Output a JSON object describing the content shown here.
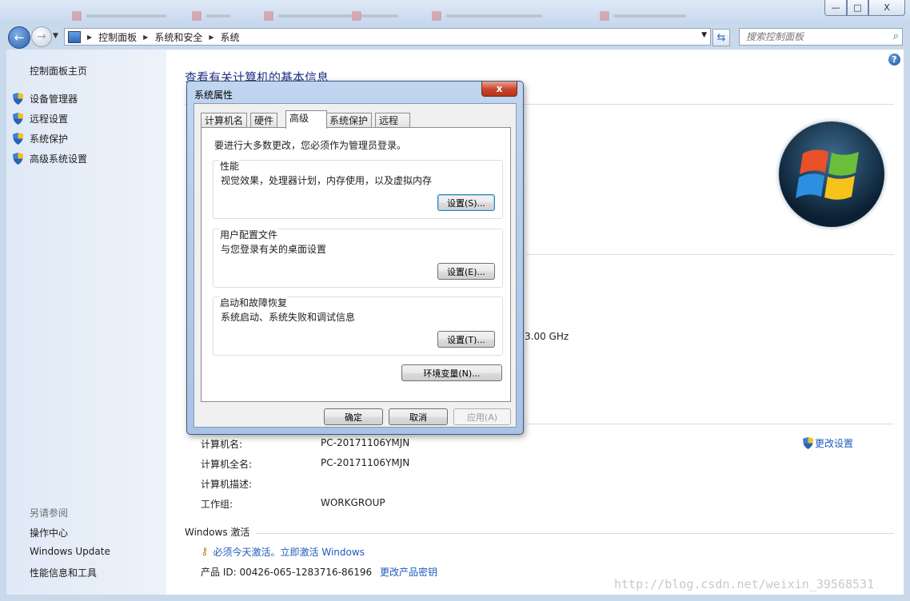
{
  "window": {
    "buttons": {
      "minimize": "—",
      "maximize": "□",
      "close": "X"
    }
  },
  "address_bar": {
    "breadcrumbs": [
      "控制面板",
      "系统和安全",
      "系统"
    ],
    "search_placeholder": "搜索控制面板"
  },
  "sidebar": {
    "home": "控制面板主页",
    "items": [
      {
        "label": "设备管理器",
        "icon": "uac-shield-icon"
      },
      {
        "label": "远程设置",
        "icon": "uac-shield-icon"
      },
      {
        "label": "系统保护",
        "icon": "uac-shield-icon"
      },
      {
        "label": "高级系统设置",
        "icon": "uac-shield-icon"
      }
    ],
    "see_also_heading": "另请参阅",
    "see_also": [
      "操作中心",
      "Windows Update",
      "性能信息和工具"
    ]
  },
  "main": {
    "title": "查看有关计算机的基本信息",
    "cpu_speed_fragment": "3.00 GHz",
    "computer_name_section": {
      "rows": [
        {
          "label": "计算机名:",
          "value": "PC-20171106YMJN"
        },
        {
          "label": "计算机全名:",
          "value": "PC-20171106YMJN"
        },
        {
          "label": "计算机描述:",
          "value": ""
        },
        {
          "label": "工作组:",
          "value": "WORKGROUP"
        }
      ],
      "change_settings": "更改设置"
    },
    "activation": {
      "heading": "Windows 激活",
      "notice": "必须今天激活。立即激活 Windows",
      "product_id_label": "产品 ID: 00426-065-1283716-86196",
      "change_key": "更改产品密钥"
    },
    "watermark": "http://blog.csdn.net/weixin_39568531"
  },
  "dialog": {
    "title": "系统属性",
    "close_label": "x",
    "tabs": [
      "计算机名",
      "硬件",
      "高级",
      "系统保护",
      "远程"
    ],
    "active_tab": "高级",
    "admin_note": "要进行大多数更改，您必须作为管理员登录。",
    "groups": [
      {
        "title": "性能",
        "desc": "视觉效果，处理器计划，内存使用，以及虚拟内存",
        "button": "设置(S)..."
      },
      {
        "title": "用户配置文件",
        "desc": "与您登录有关的桌面设置",
        "button": "设置(E)..."
      },
      {
        "title": "启动和故障恢复",
        "desc": "系统启动、系统失败和调试信息",
        "button": "设置(T)..."
      }
    ],
    "env_button": "环境变量(N)...",
    "ok": "确定",
    "cancel": "取消",
    "apply": "应用(A)"
  }
}
